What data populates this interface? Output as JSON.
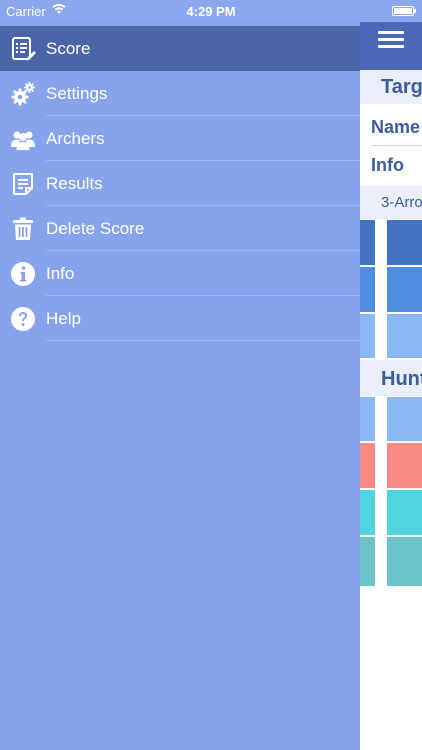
{
  "status_bar": {
    "carrier": "Carrier",
    "time": "4:29 PM"
  },
  "menu": {
    "items": [
      {
        "label": "Score",
        "icon": "score-sheet-icon",
        "selected": true
      },
      {
        "label": "Settings",
        "icon": "gears-icon",
        "selected": false
      },
      {
        "label": "Archers",
        "icon": "people-icon",
        "selected": false
      },
      {
        "label": "Results",
        "icon": "results-document-icon",
        "selected": false
      },
      {
        "label": "Delete Score",
        "icon": "trash-icon",
        "selected": false
      },
      {
        "label": "Info",
        "icon": "info-icon",
        "selected": false
      },
      {
        "label": "Help",
        "icon": "help-icon",
        "selected": false
      }
    ]
  },
  "background_content": {
    "header_1": "Targ",
    "name_label": "Name",
    "info_label": "Info",
    "sub_header": "3-Arro",
    "header_2": "Hunt"
  },
  "colors": {
    "menu_bg": "#86a3ec",
    "menu_selected": "#4a66a9",
    "nav_bar": "#4b67b5",
    "text_accent": "#3d5c99"
  }
}
